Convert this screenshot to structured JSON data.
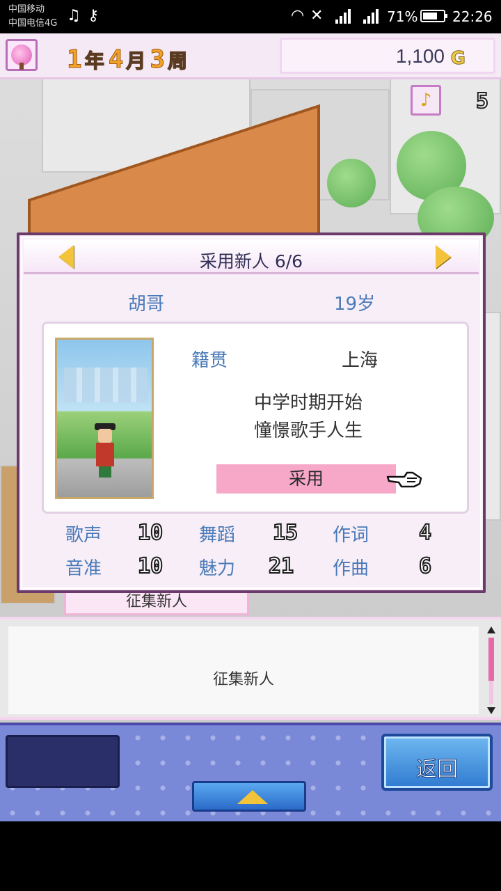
{
  "status_bar": {
    "carrier1": "中国移动",
    "carrier2": "中国电信4G",
    "battery_pct": "71%",
    "battery_level": 0.71,
    "time": "22:26",
    "icons": [
      "music-note-icon",
      "key-icon",
      "headphones-icon",
      "mute-icon",
      "signal-icon",
      "signal-4g-icon",
      "battery-icon"
    ]
  },
  "hud": {
    "year": "1",
    "year_unit": "年",
    "month": "4",
    "month_unit": "月",
    "week": "3",
    "week_unit": "周",
    "money": "1,100",
    "currency": "G",
    "trophy_count": "5"
  },
  "dialog": {
    "title": "采用新人 6/6",
    "name": "胡哥",
    "age": "19岁",
    "origin_label": "籍贯",
    "origin_value": "上海",
    "description": [
      "中学时期开始",
      "憧憬歌手人生"
    ],
    "hire_label": "采用",
    "stats": [
      [
        {
          "label": "歌声",
          "value": "10"
        },
        {
          "label": "舞蹈",
          "value": "15"
        },
        {
          "label": "作词",
          "value": "4"
        }
      ],
      [
        {
          "label": "音准",
          "value": "10"
        },
        {
          "label": "魅力",
          "value": "21"
        },
        {
          "label": "作曲",
          "value": "6"
        }
      ]
    ]
  },
  "recruit_tab": "征集新人",
  "message": "征集新人",
  "bottom": {
    "back_label": "返回"
  },
  "colors": {
    "accent_blue": "#4a7ab8",
    "hire_pink": "#f7a8c8",
    "dialog_border": "#6b3a6b"
  }
}
